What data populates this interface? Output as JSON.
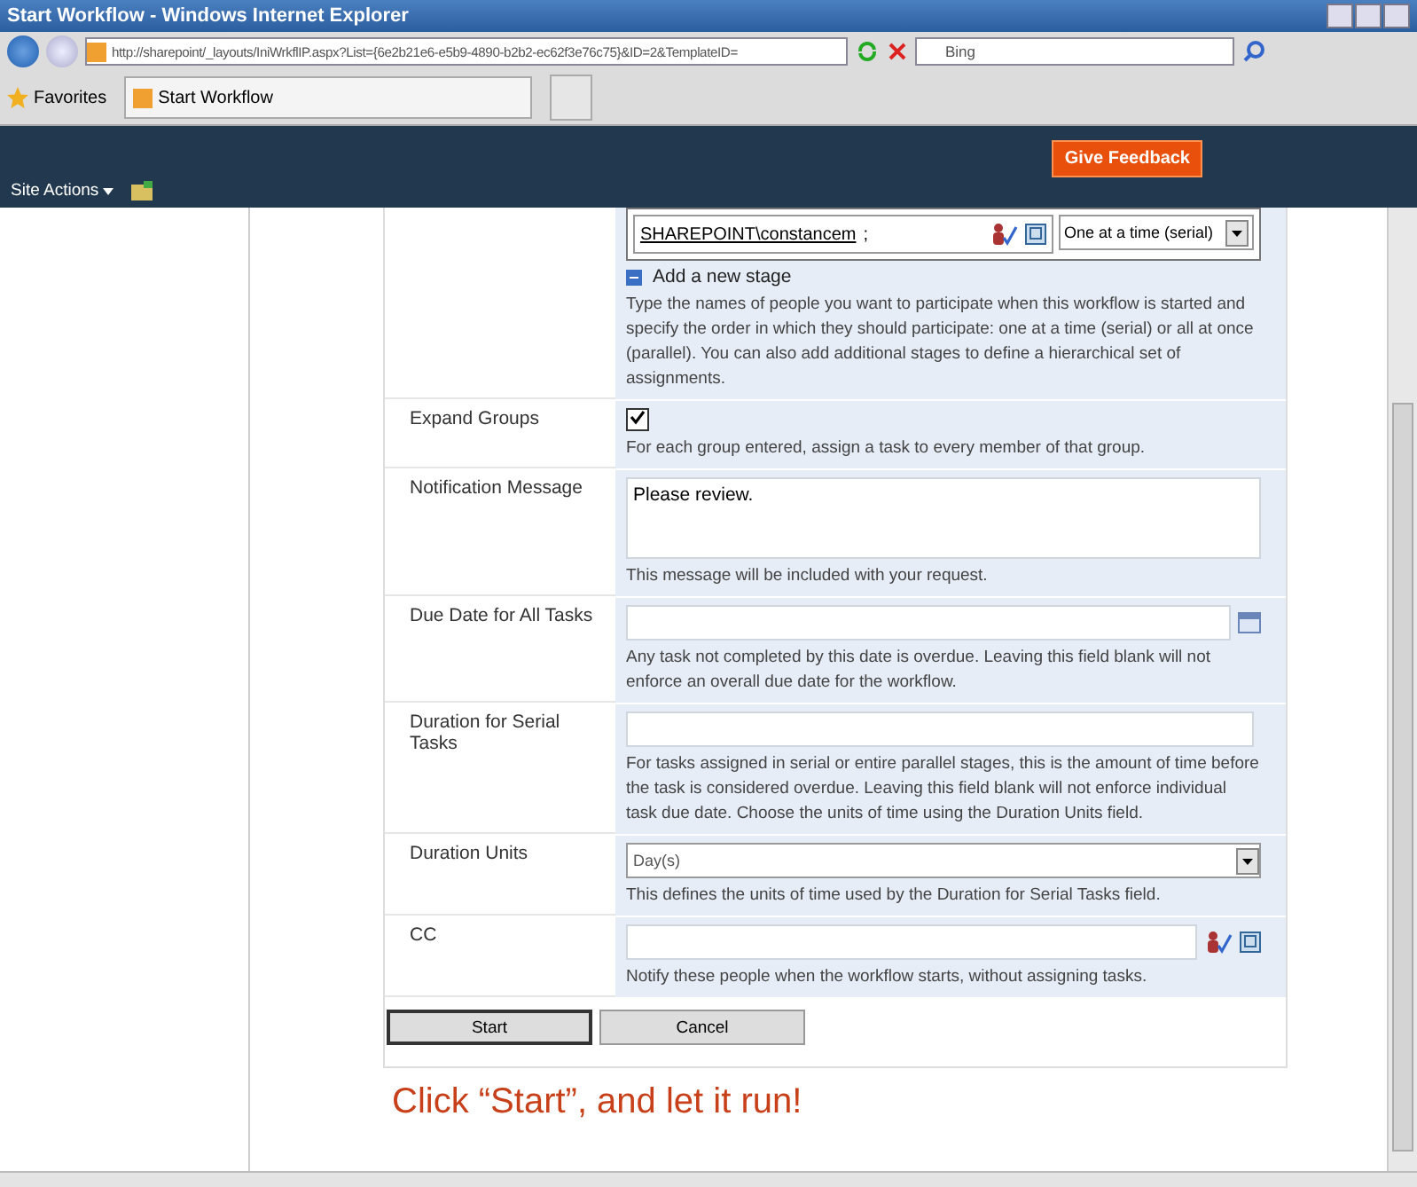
{
  "window": {
    "title": "Start Workflow - Windows Internet Explorer"
  },
  "address_bar": {
    "url": "http://sharepoint/_layouts/IniWrkflIP.aspx?List={6e2b21e6-e5b9-4890-b2b2-ec62f3e76c75}&ID=2&TemplateID="
  },
  "search": {
    "placeholder": "Bing"
  },
  "favorites": {
    "label": "Favorites",
    "tab": "Start Workflow"
  },
  "ribbon": {
    "site_actions": "Site Actions",
    "feedback": "Give Feedback"
  },
  "form": {
    "rows": [
      {
        "kind": "reviewers",
        "assignee": "SHAREPOINT\\constancem",
        "separator": ";",
        "order": "One at a time (serial)",
        "add_stage": "Add a new stage",
        "description": "Type the names of people you want to participate when this workflow is started and specify the order in which they should participate: one at a time (serial) or all at once (parallel). You can also add additional stages to define a hierarchical set of assignments."
      },
      {
        "kind": "checkbox",
        "label": "Expand Groups",
        "checked": true,
        "description": "For each group entered, assign a task to every member of that group."
      },
      {
        "kind": "textarea",
        "label": "Notification Message",
        "value": "Please review.",
        "description": "This message will be included with your request."
      },
      {
        "kind": "date",
        "label": "Due Date for All Tasks",
        "description": "Any task not completed by this date is overdue. Leaving this field blank will not enforce an overall due date for the workflow."
      },
      {
        "kind": "text",
        "label": "Duration for Serial Tasks",
        "description": "For tasks assigned in serial or entire parallel stages, this is the amount of time before the task is considered overdue. Leaving this field blank will not enforce individual task due date. Choose the units of time using the Duration Units field."
      },
      {
        "kind": "select",
        "label": "Duration Units",
        "value": "Day(s)",
        "description": "This defines the units of time used by the Duration for Serial Tasks field."
      },
      {
        "kind": "people",
        "label": "CC",
        "description": "Notify these people when the workflow starts, without assigning tasks."
      }
    ]
  },
  "buttons": [
    {
      "label": "Start",
      "selected": true
    },
    {
      "label": "Cancel",
      "selected": false
    }
  ],
  "caption": "Click “Start”, and let it run!"
}
